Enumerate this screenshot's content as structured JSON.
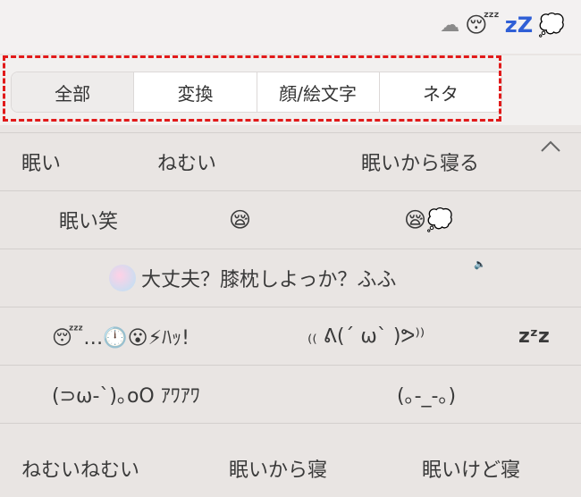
{
  "header": {
    "icons": [
      "cloud-icon",
      "sleepy-face-emoji",
      "zzz-icon",
      "thought-bubble-icon"
    ],
    "zzz_text": "zZ"
  },
  "tabs": [
    {
      "label": "全部",
      "active": true
    },
    {
      "label": "変換",
      "active": false
    },
    {
      "label": "顔/絵文字",
      "active": false
    },
    {
      "label": "ネタ",
      "active": false
    }
  ],
  "candidates": {
    "row1": [
      "眠い",
      "ねむい",
      "眠いから寝る"
    ],
    "row2": [
      "眠い笑",
      "😪",
      "😪💭"
    ],
    "row3": [
      "大丈夫？膝枕しよっか？ふふ"
    ],
    "row4": [
      "😴…🕛😮⚡ﾊｯ!",
      "₍₍ ᕕ(´ ω` )ᕗ⁾⁾",
      "zᶻz"
    ],
    "row5": [
      "(⊃ω-`)｡oO ｱﾜｱﾜ",
      "(｡-_-｡)"
    ],
    "row6": [
      "ねむいねむい",
      "眠いから寝",
      "眠いけど寝"
    ]
  },
  "colors": {
    "highlight_box": "#e11a1a",
    "zzz": "#2f5fd6"
  }
}
